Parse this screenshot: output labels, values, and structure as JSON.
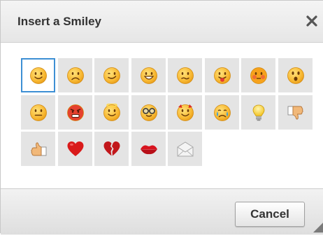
{
  "dialog": {
    "title": "Insert a Smiley",
    "close_icon": "close-icon",
    "cancel_label": "Cancel"
  },
  "smileys": [
    {
      "name": "regular-smile",
      "icon": "smile-icon",
      "selected": true
    },
    {
      "name": "sad-smile",
      "icon": "sad-icon"
    },
    {
      "name": "wink-smile",
      "icon": "wink-icon"
    },
    {
      "name": "teeth-smile",
      "icon": "teeth-icon"
    },
    {
      "name": "confused-smile",
      "icon": "confused-icon"
    },
    {
      "name": "tongue-smile",
      "icon": "tongue-icon"
    },
    {
      "name": "embarrassed-smile",
      "icon": "embarrassed-icon"
    },
    {
      "name": "omg-smile",
      "icon": "surprised-icon"
    },
    {
      "name": "whatchutalkingabout-smile",
      "icon": "neutral-icon"
    },
    {
      "name": "angry-smile",
      "icon": "angry-icon"
    },
    {
      "name": "angel-smile",
      "icon": "angel-icon"
    },
    {
      "name": "shades-smile",
      "icon": "glasses-icon"
    },
    {
      "name": "devil-smile",
      "icon": "devil-icon"
    },
    {
      "name": "cry-smile",
      "icon": "cry-icon"
    },
    {
      "name": "lightbulb",
      "icon": "lightbulb-icon"
    },
    {
      "name": "thumbs-down",
      "icon": "thumbs-down-icon"
    },
    {
      "name": "thumbs-up",
      "icon": "thumbs-up-icon"
    },
    {
      "name": "heart",
      "icon": "heart-icon"
    },
    {
      "name": "broken-heart",
      "icon": "broken-heart-icon"
    },
    {
      "name": "kiss",
      "icon": "lips-icon"
    },
    {
      "name": "envelope",
      "icon": "envelope-icon"
    }
  ]
}
